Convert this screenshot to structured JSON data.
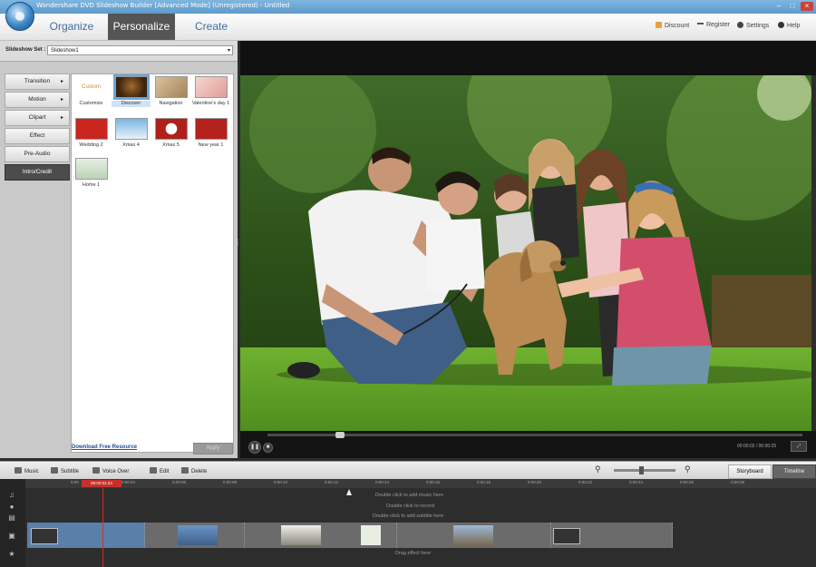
{
  "window": {
    "title": "Wondershare DVD Slideshow Builder [Advanced Mode] (Unregistered) - Untitled",
    "controls": [
      "–",
      "□",
      "×"
    ]
  },
  "nav": {
    "tabs": [
      {
        "label": "Organize"
      },
      {
        "label": "Personalize",
        "active": true
      },
      {
        "label": "Create"
      }
    ],
    "links": [
      {
        "label": "Discount",
        "icon": "discount-icon"
      },
      {
        "label": "Register",
        "icon": "key-icon"
      },
      {
        "label": "Settings",
        "icon": "gear-icon"
      },
      {
        "label": "Help",
        "icon": "help-icon"
      }
    ]
  },
  "slideshow_set": {
    "label": "Slideshow Set :",
    "value": "Slideshow1"
  },
  "categories": [
    {
      "label": "Transition",
      "chevron": "▸"
    },
    {
      "label": "Motion",
      "chevron": "▸"
    },
    {
      "label": "Clipart",
      "chevron": "▸"
    },
    {
      "label": "Effect",
      "chevron": ""
    },
    {
      "label": "Pre-Audio",
      "chevron": ""
    },
    {
      "label": "Intro/Credit",
      "chevron": "",
      "active": true
    }
  ],
  "templates": [
    {
      "label": "Customize",
      "style": "custom",
      "img_text": "Custom"
    },
    {
      "label": "Discover",
      "style": "discover",
      "selected": true
    },
    {
      "label": "Navigation",
      "style": "navigation"
    },
    {
      "label": "Valentine's day 1",
      "style": "valentine"
    },
    {
      "label": "Wedding 2",
      "style": "wedding"
    },
    {
      "label": "Xmas 4",
      "style": "xmas4"
    },
    {
      "label": "Xmas 5",
      "style": "xmas5"
    },
    {
      "label": "New year 1",
      "style": "newyear"
    },
    {
      "label": "Home 1",
      "style": "home"
    }
  ],
  "panel_footer": {
    "download_link": "Download Free Resource",
    "apply_label": "Apply"
  },
  "preview": {
    "progress": 0.13,
    "timecode": "00:00:02 / 00:00:25",
    "fullscreen_label": "⤢"
  },
  "timeline_toolbar": {
    "items": [
      {
        "label": "Music"
      },
      {
        "label": "Subtitle"
      },
      {
        "label": "Voice Over"
      },
      {
        "label": "Edit"
      },
      {
        "label": "Delete"
      }
    ],
    "zoom_level": 0.45,
    "views": [
      {
        "label": "Storyboard"
      },
      {
        "label": "Timeline",
        "active": true
      }
    ]
  },
  "timeline": {
    "current_time": "00:00:02.24",
    "ticks": [
      "0:00",
      "0:00:04",
      "0:00:06",
      "0:00:08",
      "0:00:10",
      "0:00:12",
      "0:00:14",
      "0:00:16",
      "0:00:18",
      "0:00:20",
      "0:00:22",
      "0:00:24",
      "0:00:26",
      "0:00:28"
    ],
    "hints": {
      "music": "Double click to add music here",
      "record": "Double click to record",
      "subtitle": "Double-click to add subtitle here",
      "effect": "Drag effect here"
    }
  },
  "colors": {
    "accent": "#6aa6de",
    "tab_active_bg": "#555555",
    "playhead": "#c5302c",
    "link": "#234e8b"
  }
}
